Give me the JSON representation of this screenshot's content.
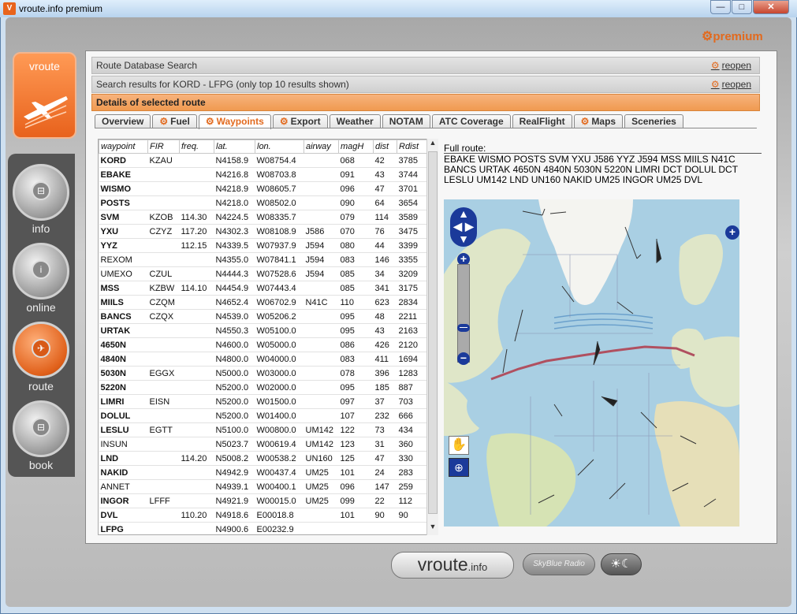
{
  "window": {
    "title": "vroute.info premium",
    "app_icon": "V",
    "buttons": {
      "minimize": "—",
      "maximize": "□",
      "close": "✕"
    }
  },
  "premium_label": "premium",
  "logo_text": "vroute",
  "nav": [
    {
      "label": "info",
      "icon": "info-icon"
    },
    {
      "label": "online",
      "icon": "online-icon"
    },
    {
      "label": "route",
      "icon": "route-icon",
      "active": true
    },
    {
      "label": "book",
      "icon": "book-icon"
    }
  ],
  "headers": {
    "db_search": "Route Database Search",
    "results": "Search results for KORD - LFPG (only top 10 results shown)",
    "details": "Details of selected route",
    "reopen": "reopen"
  },
  "tabs": [
    {
      "label": "Overview",
      "gear": false
    },
    {
      "label": "Fuel",
      "gear": true
    },
    {
      "label": "Waypoints",
      "gear": true,
      "active": true
    },
    {
      "label": "Export",
      "gear": true
    },
    {
      "label": "Weather",
      "gear": false
    },
    {
      "label": "NOTAM",
      "gear": false
    },
    {
      "label": "ATC Coverage",
      "gear": false
    },
    {
      "label": "RealFlight",
      "gear": false
    },
    {
      "label": "Maps",
      "gear": true
    },
    {
      "label": "Sceneries",
      "gear": false
    }
  ],
  "table": {
    "columns": [
      "waypoint",
      "FIR",
      "freq.",
      "lat.",
      "lon.",
      "airway",
      "magH",
      "dist",
      "Rdist"
    ],
    "rows": [
      [
        "KORD",
        "KZAU",
        "",
        "N4158.9",
        "W08754.4",
        "",
        "068",
        "42",
        "3785"
      ],
      [
        "EBAKE",
        "",
        "",
        "N4216.8",
        "W08703.8",
        "",
        "091",
        "43",
        "3744"
      ],
      [
        "WISMO",
        "",
        "",
        "N4218.9",
        "W08605.7",
        "",
        "096",
        "47",
        "3701"
      ],
      [
        "POSTS",
        "",
        "",
        "N4218.0",
        "W08502.0",
        "",
        "090",
        "64",
        "3654"
      ],
      [
        "SVM",
        "KZOB",
        "114.30",
        "N4224.5",
        "W08335.7",
        "",
        "079",
        "114",
        "3589"
      ],
      [
        "YXU",
        "CZYZ",
        "117.20",
        "N4302.3",
        "W08108.9",
        "J586",
        "070",
        "76",
        "3475"
      ],
      [
        "YYZ",
        "",
        "112.15",
        "N4339.5",
        "W07937.9",
        "J594",
        "080",
        "44",
        "3399"
      ],
      [
        "REXOM",
        "",
        "",
        "N4355.0",
        "W07841.1",
        "J594",
        "083",
        "146",
        "3355"
      ],
      [
        "UMEXO",
        "CZUL",
        "",
        "N4444.3",
        "W07528.6",
        "J594",
        "085",
        "34",
        "3209"
      ],
      [
        "MSS",
        "KZBW",
        "114.10",
        "N4454.9",
        "W07443.4",
        "",
        "085",
        "341",
        "3175"
      ],
      [
        "MIILS",
        "CZQM",
        "",
        "N4652.4",
        "W06702.9",
        "N41C",
        "110",
        "623",
        "2834"
      ],
      [
        "BANCS",
        "CZQX",
        "",
        "N4539.0",
        "W05206.2",
        "",
        "095",
        "48",
        "2211"
      ],
      [
        "URTAK",
        "",
        "",
        "N4550.3",
        "W05100.0",
        "",
        "095",
        "43",
        "2163"
      ],
      [
        "4650N",
        "",
        "",
        "N4600.0",
        "W05000.0",
        "",
        "086",
        "426",
        "2120"
      ],
      [
        "4840N",
        "",
        "",
        "N4800.0",
        "W04000.0",
        "",
        "083",
        "411",
        "1694"
      ],
      [
        "5030N",
        "EGGX",
        "",
        "N5000.0",
        "W03000.0",
        "",
        "078",
        "396",
        "1283"
      ],
      [
        "5220N",
        "",
        "",
        "N5200.0",
        "W02000.0",
        "",
        "095",
        "185",
        "887"
      ],
      [
        "LIMRI",
        "EISN",
        "",
        "N5200.0",
        "W01500.0",
        "",
        "097",
        "37",
        "703"
      ],
      [
        "DOLUL",
        "",
        "",
        "N5200.0",
        "W01400.0",
        "",
        "107",
        "232",
        "666"
      ],
      [
        "LESLU",
        "EGTT",
        "",
        "N5100.0",
        "W00800.0",
        "UM142",
        "122",
        "73",
        "434"
      ],
      [
        "INSUN",
        "",
        "",
        "N5023.7",
        "W00619.4",
        "UM142",
        "123",
        "31",
        "360"
      ],
      [
        "LND",
        "",
        "114.20",
        "N5008.2",
        "W00538.2",
        "UN160",
        "125",
        "47",
        "330"
      ],
      [
        "NAKID",
        "",
        "",
        "N4942.9",
        "W00437.4",
        "UM25",
        "101",
        "24",
        "283"
      ],
      [
        "ANNET",
        "",
        "",
        "N4939.1",
        "W00400.1",
        "UM25",
        "096",
        "147",
        "259"
      ],
      [
        "INGOR",
        "LFFF",
        "",
        "N4921.9",
        "W00015.0",
        "UM25",
        "099",
        "22",
        "112"
      ],
      [
        "DVL",
        "",
        "110.20",
        "N4918.6",
        "E00018.8",
        "",
        "101",
        "90",
        "90"
      ],
      [
        "LFPG",
        "",
        "",
        "N4900.6",
        "E00232.9",
        "",
        "",
        "",
        ""
      ]
    ],
    "bold_waypoints": [
      "KORD",
      "EBAKE",
      "WISMO",
      "POSTS",
      "SVM",
      "YXU",
      "YYZ",
      "MSS",
      "MIILS",
      "BANCS",
      "URTAK",
      "4650N",
      "4840N",
      "5030N",
      "5220N",
      "LIMRI",
      "DOLUL",
      "LESLU",
      "LND",
      "NAKID",
      "INGOR",
      "DVL",
      "LFPG"
    ]
  },
  "full_route": {
    "label": "Full route:",
    "text": "EBAKE WISMO POSTS SVM YXU J586 YYZ J594 MSS MIILS N41C BANCS URTAK 4650N 4840N 5030N 5220N LIMRI DCT DOLUL DCT LESLU UM142 LND UN160 NAKID UM25 INGOR UM25 DVL"
  },
  "footer": {
    "brand": "vroute",
    "brand_suffix": ".info",
    "skyblue": "SkyBlue Radio",
    "daynight_icon": "sun-moon-icon"
  },
  "colors": {
    "accent": "#e26a1e",
    "route": "#b05060"
  }
}
